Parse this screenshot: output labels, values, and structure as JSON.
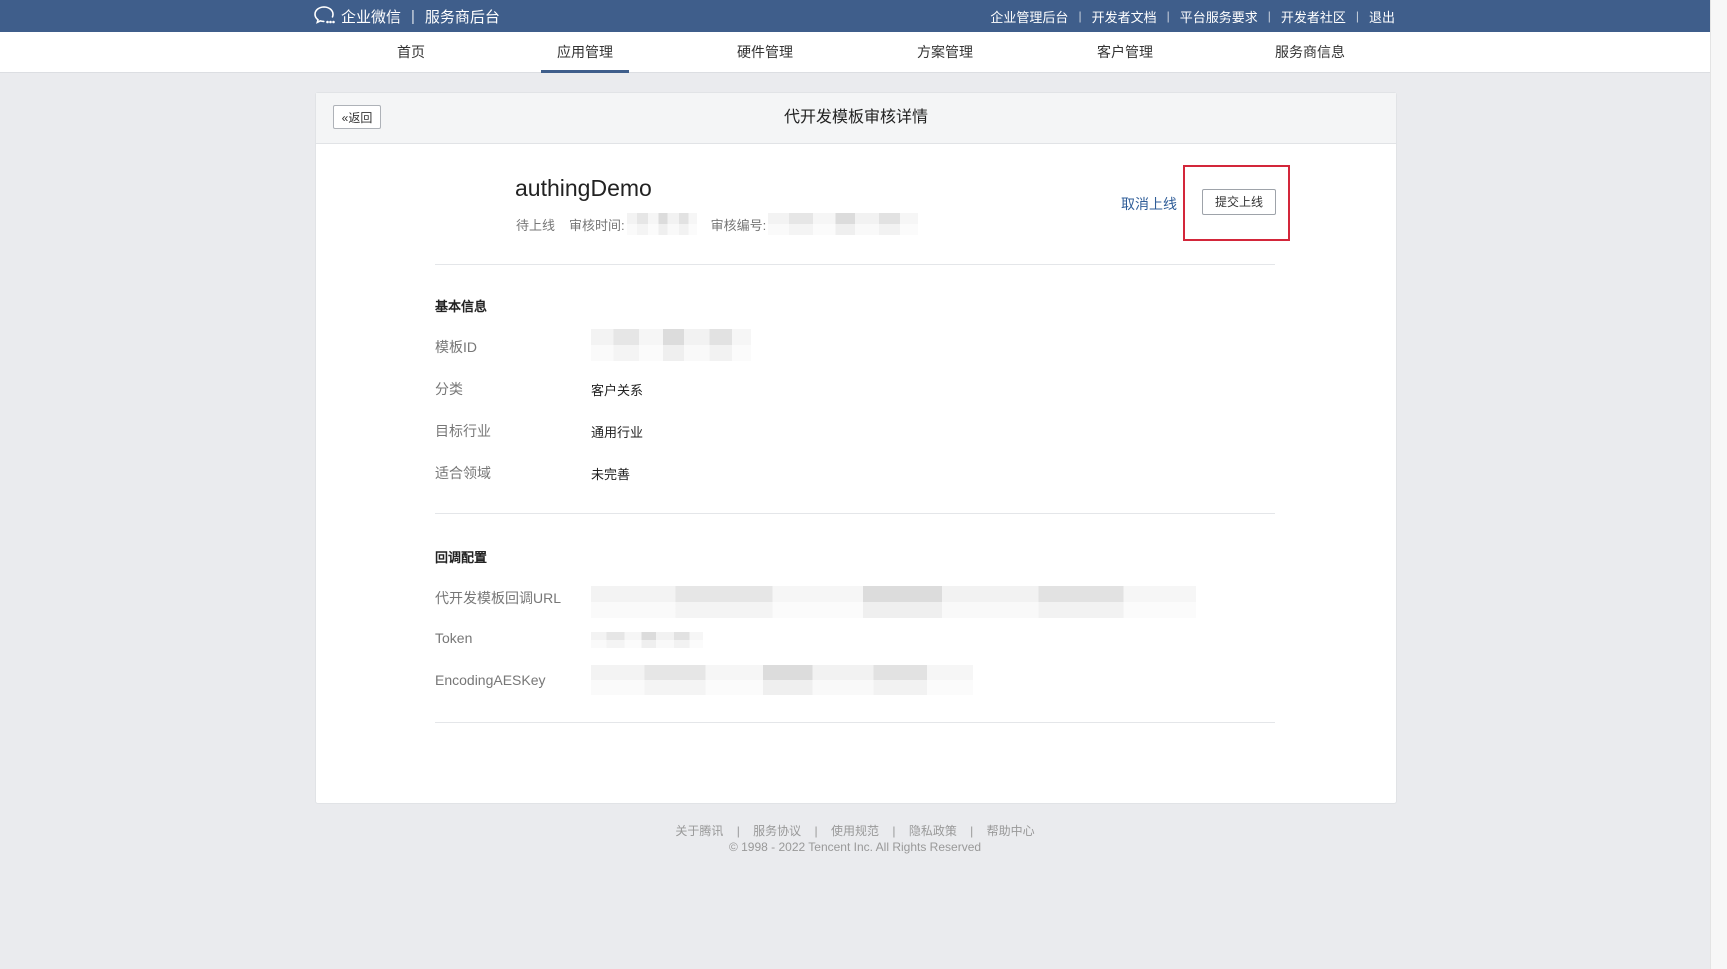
{
  "topbar": {
    "brand_name": "企业微信",
    "brand_divider": "|",
    "brand_sub": "服务商后台",
    "links": [
      "企业管理后台",
      "开发者文档",
      "平台服务要求",
      "开发者社区",
      "退出"
    ],
    "divider": "|"
  },
  "nav": {
    "items": [
      "首页",
      "应用管理",
      "硬件管理",
      "方案管理",
      "客户管理",
      "服务商信息"
    ],
    "active": "应用管理"
  },
  "card": {
    "back_label": "返回",
    "back_icon": "«",
    "title": "代开发模板审核详情",
    "app_name": "authingDemo",
    "status": "待上线",
    "review_time_label": "审核时间:",
    "review_no_label": "审核编号:",
    "cancel_label": "取消上线",
    "submit_label": "提交上线",
    "highlight_color": "#d3263a"
  },
  "basic": {
    "title": "基本信息",
    "rows": [
      {
        "label": "模板ID",
        "value": ""
      },
      {
        "label": "分类",
        "value": "客户关系"
      },
      {
        "label": "目标行业",
        "value": "通用行业"
      },
      {
        "label": "适合领域",
        "value": "未完善"
      }
    ]
  },
  "callback": {
    "title": "回调配置",
    "rows": [
      {
        "label": "代开发模板回调URL",
        "value": ""
      },
      {
        "label": "Token",
        "value": ""
      },
      {
        "label": "EncodingAESKey",
        "value": ""
      }
    ]
  },
  "footer": {
    "links": [
      "关于腾讯",
      "服务协议",
      "使用规范",
      "隐私政策",
      "帮助中心"
    ],
    "divider": "|",
    "copyright": "© 1998 - 2022 Tencent Inc. All Rights Reserved"
  },
  "colors": {
    "topbar": "#3f5e8b",
    "link": "#2f5d98",
    "page_bg": "#eaebee"
  }
}
